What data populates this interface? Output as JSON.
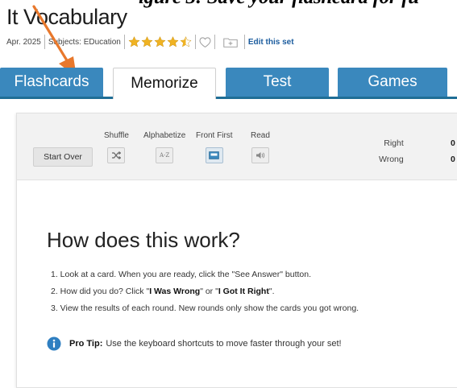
{
  "caption": "igure 3: Save your flashcard for fu",
  "set": {
    "title": "It Vocabulary",
    "date": "Apr. 2025",
    "subjects": "Subjects: EDucation",
    "edit_label": "Edit this set",
    "rating": 4.5
  },
  "tabs": [
    {
      "label": "Flashcards"
    },
    {
      "label": "Memorize"
    },
    {
      "label": "Test"
    },
    {
      "label": "Games"
    }
  ],
  "toolbar": {
    "start_over": "Start Over",
    "shuffle": "Shuffle",
    "alphabetize": "Alphabetize",
    "alphabetize_icon_text": "A-Z",
    "front_first": "Front First",
    "read": "Read"
  },
  "score": {
    "right_label": "Right",
    "wrong_label": "Wrong",
    "right_value": "0",
    "wrong_value": "0"
  },
  "how": {
    "title": "How does this work?",
    "step1": "1. Look at a card. When you are ready, click the \"See Answer\" button.",
    "step2_pre": "2. How did you do? Click \"",
    "step2_wrong": "I Was Wrong",
    "step2_mid": "\" or \"",
    "step2_right": "I Got It Right",
    "step2_post": "\".",
    "step3": "3. View the results of each round. New rounds only show the cards you got wrong."
  },
  "tip": {
    "label": "Pro Tip:",
    "text": "Use the keyboard shortcuts to move faster through your set!"
  },
  "colors": {
    "tab_blue": "#3a88bd",
    "star_gold": "#f0b323",
    "link_blue": "#1b5c9e",
    "arrow_orange": "#e8782c",
    "info_blue": "#2f7fc1"
  }
}
